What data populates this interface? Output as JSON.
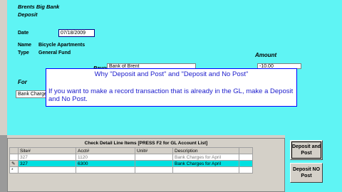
{
  "header": {
    "company": "Brents Big Bank",
    "doc_type": "Deposit"
  },
  "form": {
    "date_label": "Date",
    "date_value": "07/18/2009",
    "name_label": "Name",
    "name_value": "Bicycle Apartments",
    "type_label": "Type",
    "type_value": "General Fund",
    "payor_label": "Payor",
    "payor_value": "Bank of Brent",
    "amount_label": "Amount",
    "amount_value": "-10.00",
    "for_label": "For",
    "for_value": "Bank Charges"
  },
  "callout": {
    "title": "Why \"Deposit and Post\" and \"Deposit and No Post\"",
    "body": "If you want to make a record transaction that is already in the GL, make a Deposit and No Post."
  },
  "detail": {
    "title": "Check Detail Line Items [PRESS F2 for GL Account List]",
    "columns": [
      "Site#",
      "Acct#",
      "Unit#",
      "Description"
    ],
    "rows": [
      {
        "marker": "",
        "site": "327",
        "acct": "1120",
        "unit": "",
        "desc": "Bank Charges for April"
      },
      {
        "marker": "✎",
        "site": "327",
        "acct": "6300",
        "unit": "",
        "desc": "Bank Charges for April"
      },
      {
        "marker": "*",
        "site": "",
        "acct": "",
        "unit": "",
        "desc": ""
      }
    ]
  },
  "buttons": {
    "deposit_post": "Deposit and Post",
    "deposit_no_post": "Deposit NO Post"
  },
  "colors": {
    "form_bg": "#5ff4f4",
    "selected_row": "#00e0e0",
    "callout_text": "#1a1acc"
  }
}
